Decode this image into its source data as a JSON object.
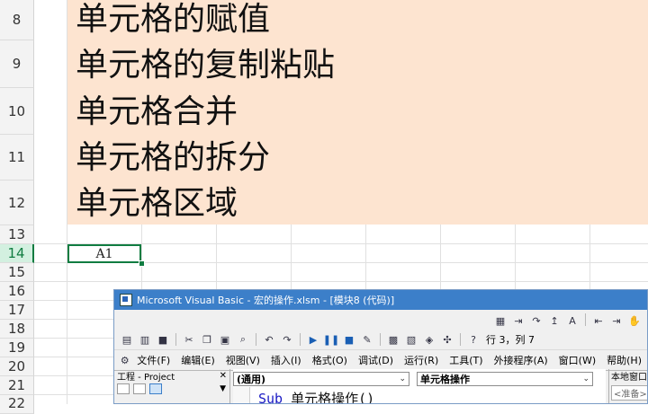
{
  "spreadsheet": {
    "rows": [
      {
        "num": "8",
        "text": "单元格的赋值"
      },
      {
        "num": "9",
        "text": "单元格的复制粘贴"
      },
      {
        "num": "10",
        "text": "单元格合并"
      },
      {
        "num": "11",
        "text": "单元格的拆分"
      },
      {
        "num": "12",
        "text": "单元格区域"
      }
    ],
    "empty_rows": [
      "13",
      "14",
      "15",
      "16",
      "17",
      "18",
      "19",
      "20",
      "21",
      "22"
    ],
    "active_row": "14",
    "selected_cell_value": "A1",
    "highlight_color": "#fde4d0",
    "accent_color": "#107c41"
  },
  "vbe": {
    "title": "Microsoft Visual Basic - 宏的操作.xlsm - [模块8 (代码)]",
    "cursor_position": "行 3，列 7",
    "menus": [
      "文件(F)",
      "编辑(E)",
      "视图(V)",
      "插入(I)",
      "格式(O)",
      "调试(D)",
      "运行(R)",
      "工具(T)",
      "外接程序(A)",
      "窗口(W)",
      "帮助(H)"
    ],
    "project_pane_title": "工程 - Project",
    "object_combo": "(通用)",
    "procedure_combo": "单元格操作",
    "code_keyword": "Sub",
    "code_name": " 单元格操作()",
    "locals_title": "本地窗口",
    "locals_value": "<准备>",
    "title_color": "#3c7fc9"
  }
}
